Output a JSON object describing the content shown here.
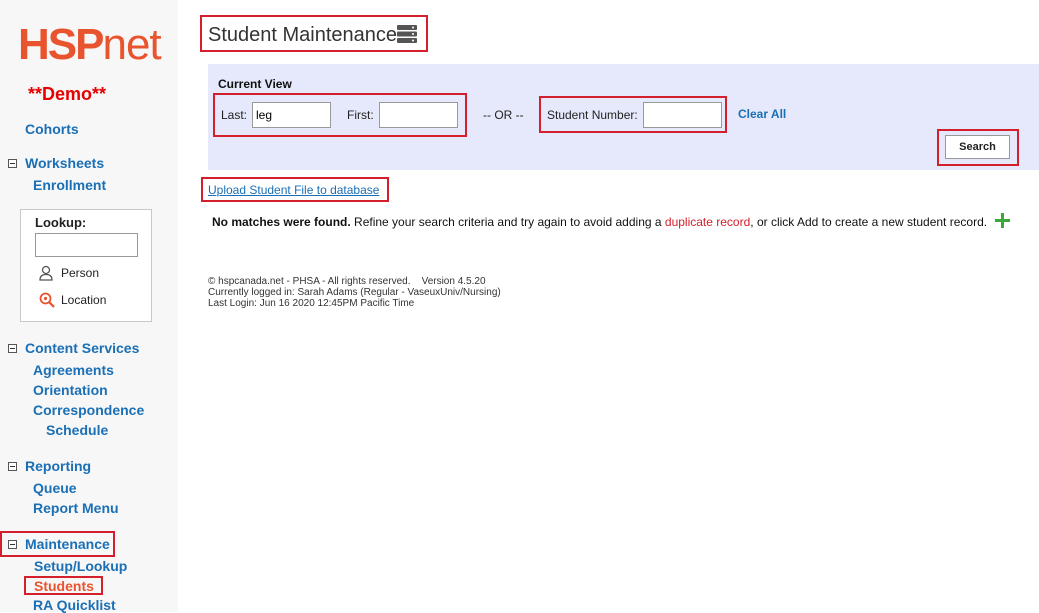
{
  "logo": {
    "hsp": "HSP",
    "net": "net"
  },
  "demo_label": "**Demo**",
  "sidebar": {
    "cohorts": "Cohorts",
    "worksheets": {
      "label": "Worksheets",
      "items": [
        "Enrollment"
      ]
    },
    "lookup": {
      "label": "Lookup:",
      "person": "Person",
      "location": "Location"
    },
    "content_services": {
      "label": "Content Services",
      "items": [
        "Agreements",
        "Orientation",
        "Correspondence",
        "Schedule"
      ]
    },
    "reporting": {
      "label": "Reporting",
      "items": [
        "Queue",
        "Report Menu"
      ]
    },
    "maintenance": {
      "label": "Maintenance",
      "items": [
        "Setup/Lookup",
        "Students",
        "RA Quicklist"
      ]
    }
  },
  "page": {
    "title": "Student Maintenance",
    "title_icon": "database-icon"
  },
  "current_view": {
    "label": "Current View",
    "last_label": "Last:",
    "last_value": "leg",
    "first_label": "First:",
    "first_value": "",
    "or_label": "-- OR --",
    "student_number_label": "Student Number:",
    "student_number_value": "",
    "clear_all": "Clear All",
    "search_button": "Search"
  },
  "upload_link": "Upload Student File to database",
  "message": {
    "bold": "No matches were found.",
    "part1": " Refine your search criteria and try again to avoid adding a ",
    "link": "duplicate record",
    "part2": ", or click Add to create a new student record."
  },
  "footer": {
    "line1": "© hspcanada.net - PHSA - All rights reserved.    Version 4.5.20",
    "line2": "Currently logged in: Sarah Adams (Regular - VaseuxUniv/Nursing)",
    "line3": "Last Login: Jun 16 2020 12:45PM Pacific Time"
  },
  "colors": {
    "accent": "#1a6fb5",
    "highlight": "#d4202c",
    "panel": "#e6e9fb",
    "logo": "#e8542d",
    "add": "#3aa935"
  }
}
